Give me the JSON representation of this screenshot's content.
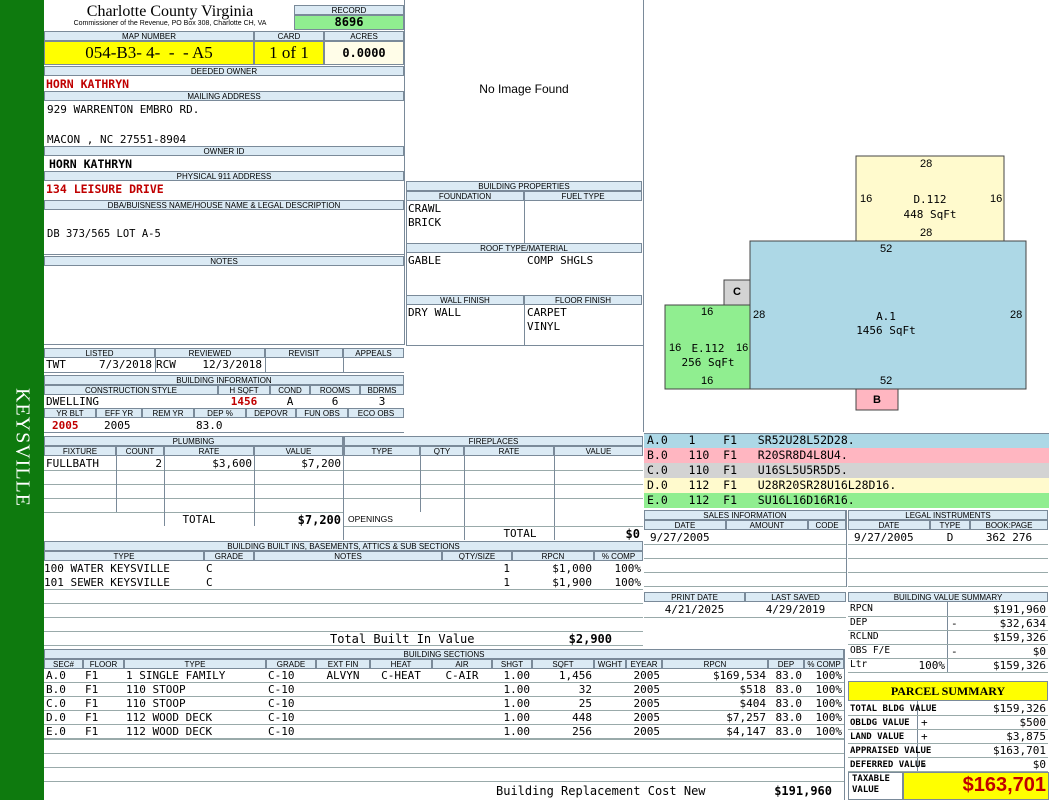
{
  "sidebar": {
    "label": "KEYSVILLE"
  },
  "header": {
    "county": "Charlotte County Virginia",
    "sub": "Commissioner of the Revenue, PO Box 308, Charlotte CH, VA",
    "record_label": "RECORD",
    "record": "8696",
    "map_label": "MAP NUMBER",
    "map": "054-B3- 4-  -  - A5",
    "card_label": "CARD",
    "card": "1 of 1",
    "acres_label": "ACRES",
    "acres": "0.0000"
  },
  "owner": {
    "deeded_label": "DEEDED OWNER",
    "deeded": "HORN KATHRYN",
    "mailing_label": "MAILING ADDRESS",
    "addr1": "929 WARRENTON EMBRO RD.",
    "addr2": "MACON , NC 27551-8904",
    "ownerid_label": "OWNER ID",
    "ownerid": "HORN KATHRYN",
    "physical_label": "PHYSICAL 911 ADDRESS",
    "physical": "134 LEISURE DRIVE",
    "dba_label": "DBA/BUISNESS NAME/HOUSE NAME & LEGAL DESCRIPTION",
    "dba": "DB 373/565 LOT A-5",
    "notes_label": "NOTES"
  },
  "listing": {
    "listed_label": "LISTED",
    "reviewed_label": "REVIEWED",
    "revisit_label": "REVISIT",
    "appeals_label": "APPEALS",
    "listed_by": "TWT",
    "listed_date": "7/3/2018",
    "reviewed_by": "RCW",
    "reviewed_date": "12/3/2018"
  },
  "building_info": {
    "title": "BUILDING INFORMATION",
    "h": [
      "CONSTRUCTION STYLE",
      "H SQFT",
      "COND",
      "ROOMS",
      "BDRMS"
    ],
    "style": "DWELLING",
    "sqft": "1456",
    "cond": "A",
    "rooms": "6",
    "bdrms": "3",
    "h2": [
      "YR BLT",
      "EFF YR",
      "REM YR",
      "DEP %",
      "DEPOVR",
      "FUN OBS",
      "ECO OBS"
    ],
    "yr_blt": "2005",
    "eff_yr": "2005",
    "dep": "83.0"
  },
  "image": {
    "text": "No Image Found"
  },
  "building_props": {
    "title": "BUILDING PROPERTIES",
    "foundation_label": "FOUNDATION",
    "fuel_label": "FUEL TYPE",
    "foundation": [
      "CRAWL",
      "BRICK"
    ],
    "roof_label": "ROOF TYPE/MATERIAL",
    "roof_type": "GABLE",
    "roof_mat": "COMP SHGLS",
    "wall_label": "WALL FINISH",
    "floor_label": "FLOOR FINISH",
    "wall": "DRY WALL",
    "floor": [
      "CARPET",
      "VINYL"
    ]
  },
  "sketch": {
    "d_label": "D.112",
    "d_area": "448 SqFt",
    "a_label": "A.1",
    "a_area": "1456 SqFt",
    "e_label": "E.112",
    "e_area": "256 SqFt",
    "c_label": "C",
    "b_label": "B",
    "dims": {
      "d_top": "28",
      "d_left": "16",
      "d_right": "16",
      "d_bottom": "28",
      "a_top": "52",
      "a_left": "28",
      "a_right": "28",
      "a_bottom": "52",
      "e_top": "16",
      "e_left": "16",
      "e_right": "16",
      "e_bottom": "16"
    }
  },
  "sketch_codes": [
    {
      "text": "A.0   1    F1   SR52U28L52D28.",
      "color": "#add8e6"
    },
    {
      "text": "B.0   110  F1   R20SR8D4L8U4.",
      "color": "#ffb6c1"
    },
    {
      "text": "C.0   110  F1   U16SL5U5R5D5.",
      "color": "#d3d3d3"
    },
    {
      "text": "D.0   112  F1   U28R20SR28U16L28D16.",
      "color": "#fffacd"
    },
    {
      "text": "E.0   112  F1   SU16L16D16R16.",
      "color": "#90ee90"
    }
  ],
  "plumbing": {
    "title": "PLUMBING",
    "h": [
      "FIXTURE",
      "COUNT",
      "RATE",
      "VALUE"
    ],
    "rows": [
      [
        "FULLBATH",
        "2",
        "$3,600",
        "$7,200"
      ]
    ],
    "total_label": "TOTAL",
    "total": "$7,200"
  },
  "fireplaces": {
    "title": "FIREPLACES",
    "h": [
      "TYPE",
      "QTY",
      "RATE",
      "VALUE"
    ],
    "openings_label": "OPENINGS",
    "total_label": "TOTAL",
    "total": "$0"
  },
  "builtins": {
    "title": "BUILDING BUILT INS, BASEMENTS, ATTICS & SUB SECTIONS",
    "h": [
      "TYPE",
      "GRADE",
      "NOTES",
      "QTY/SIZE",
      "RPCN",
      "% COMP"
    ],
    "rows": [
      [
        "100 WATER KEYSVILLE",
        "C",
        "",
        "1",
        "$1,000",
        "100%"
      ],
      [
        "101 SEWER KEYSVILLE",
        "C",
        "",
        "1",
        "$1,900",
        "100%"
      ]
    ],
    "total_label": "Total Built In Value",
    "total": "$2,900"
  },
  "sales": {
    "title": "SALES INFORMATION",
    "h": [
      "DATE",
      "AMOUNT",
      "CODE"
    ],
    "rows": [
      [
        "9/27/2005",
        "",
        ""
      ]
    ]
  },
  "legal": {
    "title": "LEGAL INSTRUMENTS",
    "h": [
      "DATE",
      "TYPE",
      "BOOK:PAGE"
    ],
    "rows": [
      [
        "9/27/2005",
        "D",
        "362 276"
      ]
    ]
  },
  "print": {
    "print_label": "PRINT DATE",
    "saved_label": "LAST SAVED",
    "print_date": "4/21/2025",
    "saved_date": "4/29/2019"
  },
  "value_summary": {
    "title": "BUILDING VALUE SUMMARY",
    "rows": [
      {
        "label": "RPCN",
        "pct": "",
        "sign": "",
        "value": "$191,960"
      },
      {
        "label": "DEP",
        "pct": "",
        "sign": "-",
        "value": "$32,634"
      },
      {
        "label": "RCLND",
        "pct": "",
        "sign": "",
        "value": "$159,326"
      },
      {
        "label": "OBS F/E",
        "pct": "",
        "sign": "-",
        "value": "$0"
      },
      {
        "label": "Ltr",
        "pct": "100%",
        "sign": "",
        "value": "$159,326"
      }
    ]
  },
  "parcel": {
    "title": "PARCEL SUMMARY",
    "rows": [
      {
        "label": "TOTAL BLDG VALUE",
        "sign": "",
        "value": "$159,326"
      },
      {
        "label": "OBLDG VALUE",
        "sign": "+",
        "value": "$500"
      },
      {
        "label": "LAND VALUE",
        "sign": "+",
        "value": "$3,875"
      },
      {
        "label": "APPRAISED VALUE",
        "sign": "",
        "value": "$163,701"
      },
      {
        "label": "DEFERRED VALUE",
        "sign": "-",
        "value": "$0"
      }
    ],
    "taxable_label1": "TAXABLE",
    "taxable_label2": "VALUE",
    "taxable": "$163,701"
  },
  "sections": {
    "title": "BUILDING SECTIONS",
    "h": [
      "SEC#",
      "FLOOR",
      "TYPE",
      "GRADE",
      "EXT FIN",
      "HEAT",
      "AIR",
      "SHGT",
      "SQFT",
      "WGHT",
      "EYEAR",
      "RPCN",
      "DEP",
      "% COMP"
    ],
    "rows": [
      [
        "A.0",
        "F1",
        "1 SINGLE FAMILY",
        "C-10",
        "ALVYN",
        "C-HEAT",
        "C-AIR",
        "1.00",
        "1,456",
        "",
        "2005",
        "$169,534",
        "83.0",
        "100%"
      ],
      [
        "B.0",
        "F1",
        "110 STOOP",
        "C-10",
        "",
        "",
        "",
        "1.00",
        "32",
        "",
        "2005",
        "$518",
        "83.0",
        "100%"
      ],
      [
        "C.0",
        "F1",
        "110 STOOP",
        "C-10",
        "",
        "",
        "",
        "1.00",
        "25",
        "",
        "2005",
        "$404",
        "83.0",
        "100%"
      ],
      [
        "D.0",
        "F1",
        "112 WOOD DECK",
        "C-10",
        "",
        "",
        "",
        "1.00",
        "448",
        "",
        "2005",
        "$7,257",
        "83.0",
        "100%"
      ],
      [
        "E.0",
        "F1",
        "112 WOOD DECK",
        "C-10",
        "",
        "",
        "",
        "1.00",
        "256",
        "",
        "2005",
        "$4,147",
        "83.0",
        "100%"
      ]
    ],
    "total_label": "Building Replacement Cost New",
    "total": "$191,960"
  }
}
